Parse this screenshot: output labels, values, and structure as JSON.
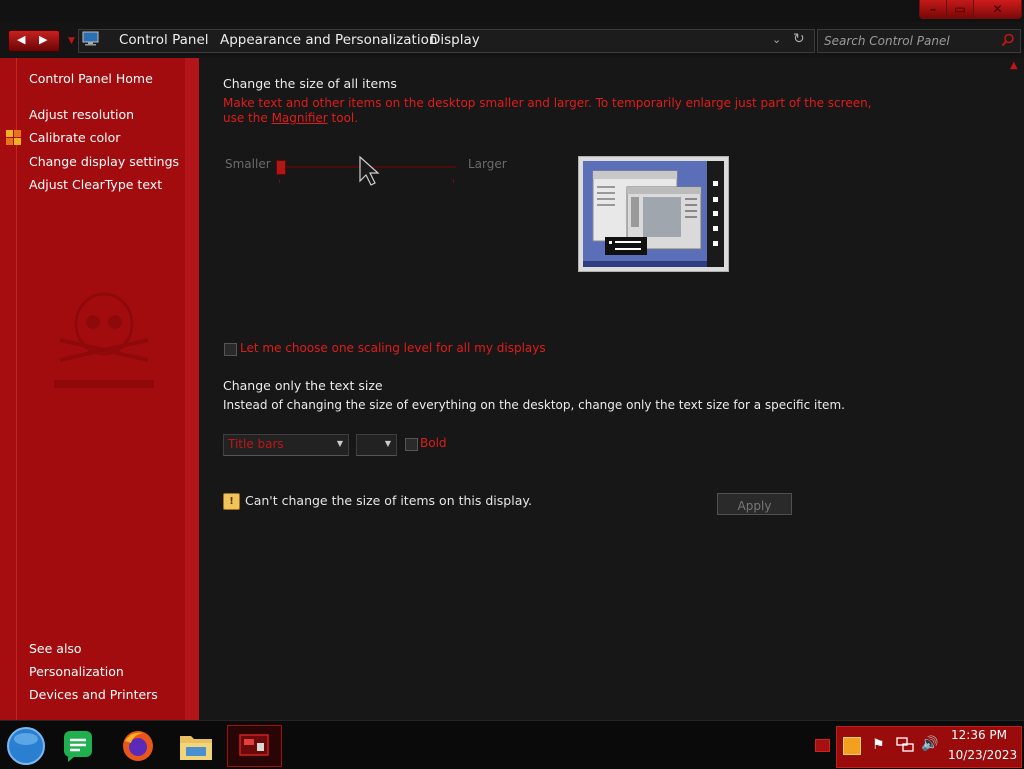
{
  "window": {
    "min_label": "–",
    "max_label": "▭",
    "close_label": "✕"
  },
  "address": {
    "crumbs": [
      "Control Panel",
      "Appearance and Personalization",
      "Display"
    ],
    "search_placeholder": "Search Control Panel"
  },
  "sidebar": {
    "home": "Control Panel Home",
    "links": [
      "Adjust resolution",
      "Calibrate color",
      "Change display settings",
      "Adjust ClearType text"
    ],
    "see_also_heading": "See also",
    "see_also": [
      "Personalization",
      "Devices and Printers"
    ]
  },
  "main": {
    "heading": "Change the size of all items",
    "desc_line1": "Make text and other items on the desktop smaller and larger. To temporarily enlarge just part of the screen,",
    "desc_use": "use the ",
    "magnifier_link": "Magnifier",
    "desc_tool": " tool.",
    "smaller_label": "Smaller",
    "larger_label": "Larger",
    "slider_value": 0,
    "scaling_checkbox_label": "Let me choose one scaling level for all my displays",
    "text_size_heading": "Change only the text size",
    "text_size_desc": "Instead of changing the size of everything on the desktop, change only the text size for a specific item.",
    "item_select_value": "Title bars",
    "size_select_value": "",
    "bold_label": "Bold",
    "warning_text": "Can't change the size of items on this display.",
    "apply_label": "Apply"
  },
  "taskbar": {
    "time": "12:36 PM",
    "date": "10/23/2023"
  },
  "colors": {
    "accent_red": "#e11c1c",
    "sidebar_red": "#a50d10",
    "main_bg": "#171717"
  },
  "icons": [
    "search-icon",
    "control-panel-icon",
    "calibrate-color-icon",
    "warning-icon",
    "start-orb-icon",
    "messages-icon",
    "firefox-icon",
    "file-explorer-icon",
    "control-panel-app-icon",
    "flag-icon",
    "network-icon",
    "volume-icon"
  ]
}
